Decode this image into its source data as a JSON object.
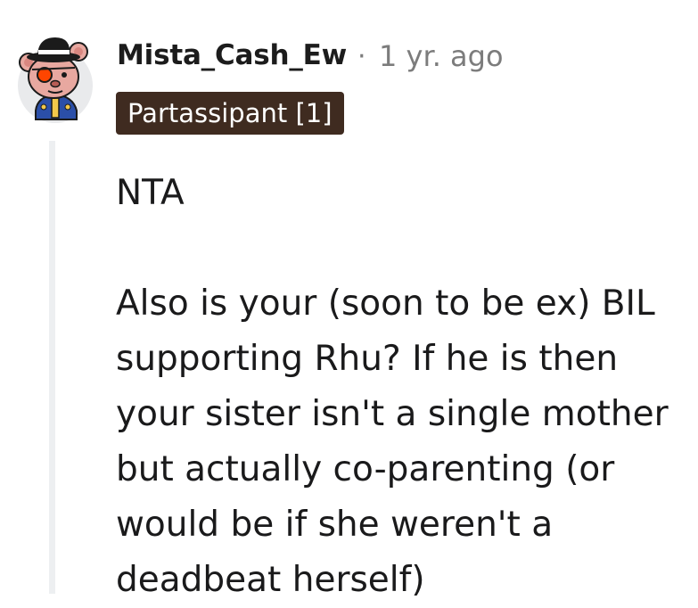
{
  "comment": {
    "author": "Mista_Cash_Ew",
    "separator": "·",
    "timestamp": "1 yr. ago",
    "flair": "Partassipant [1]",
    "paragraphs": [
      "NTA",
      "Also is your (soon to be ex) BIL supporting Rhu? If he is then your sister isn't a single mother but actually co-parenting (or would be if she weren't a deadbeat herself)"
    ],
    "avatar": {
      "icon": "snoo-avatar-icon",
      "hat_color": "#1b1b1b",
      "fur_color": "#e8a8a0",
      "eye_patch_color": "#ff4500",
      "jacket_color": "#2b4fa8",
      "background_color": "#e9eaec"
    },
    "flair_background": "#3f2b20",
    "thread_line_color": "#edeff1"
  }
}
